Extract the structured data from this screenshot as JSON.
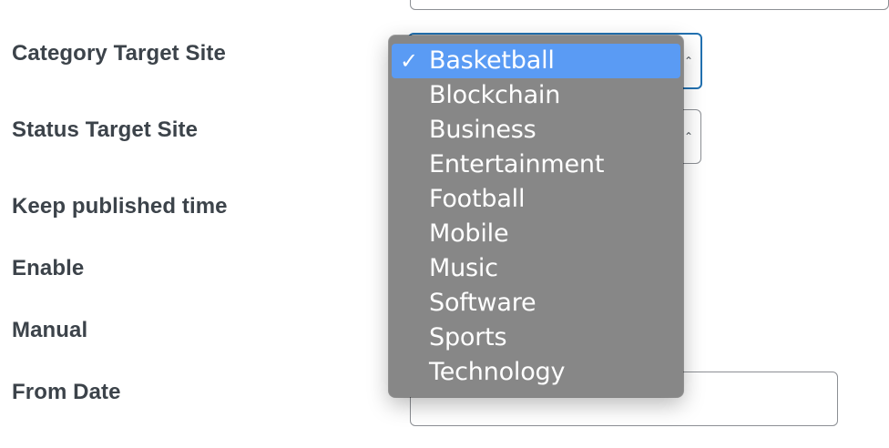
{
  "form": {
    "rows": [
      {
        "label": "Category Target Site"
      },
      {
        "label": "Status Target Site"
      },
      {
        "label": "Keep published time"
      },
      {
        "label": "Enable"
      },
      {
        "label": "Manual"
      },
      {
        "label": "From Date"
      }
    ]
  },
  "dropdown": {
    "selected": "Basketball",
    "options": [
      "Basketball",
      "Blockchain",
      "Business",
      "Entertainment",
      "Football",
      "Mobile",
      "Music",
      "Software",
      "Sports",
      "Technology"
    ]
  },
  "icons": {
    "check": "checkmark-icon",
    "select_arrow": "chevron-updown-icon"
  },
  "colors": {
    "label": "#3c434a",
    "dropdown_bg": "#878787",
    "selected_highlight": "#5a9bf4",
    "focus_border": "#2271b1",
    "input_border": "#8c8f94"
  }
}
